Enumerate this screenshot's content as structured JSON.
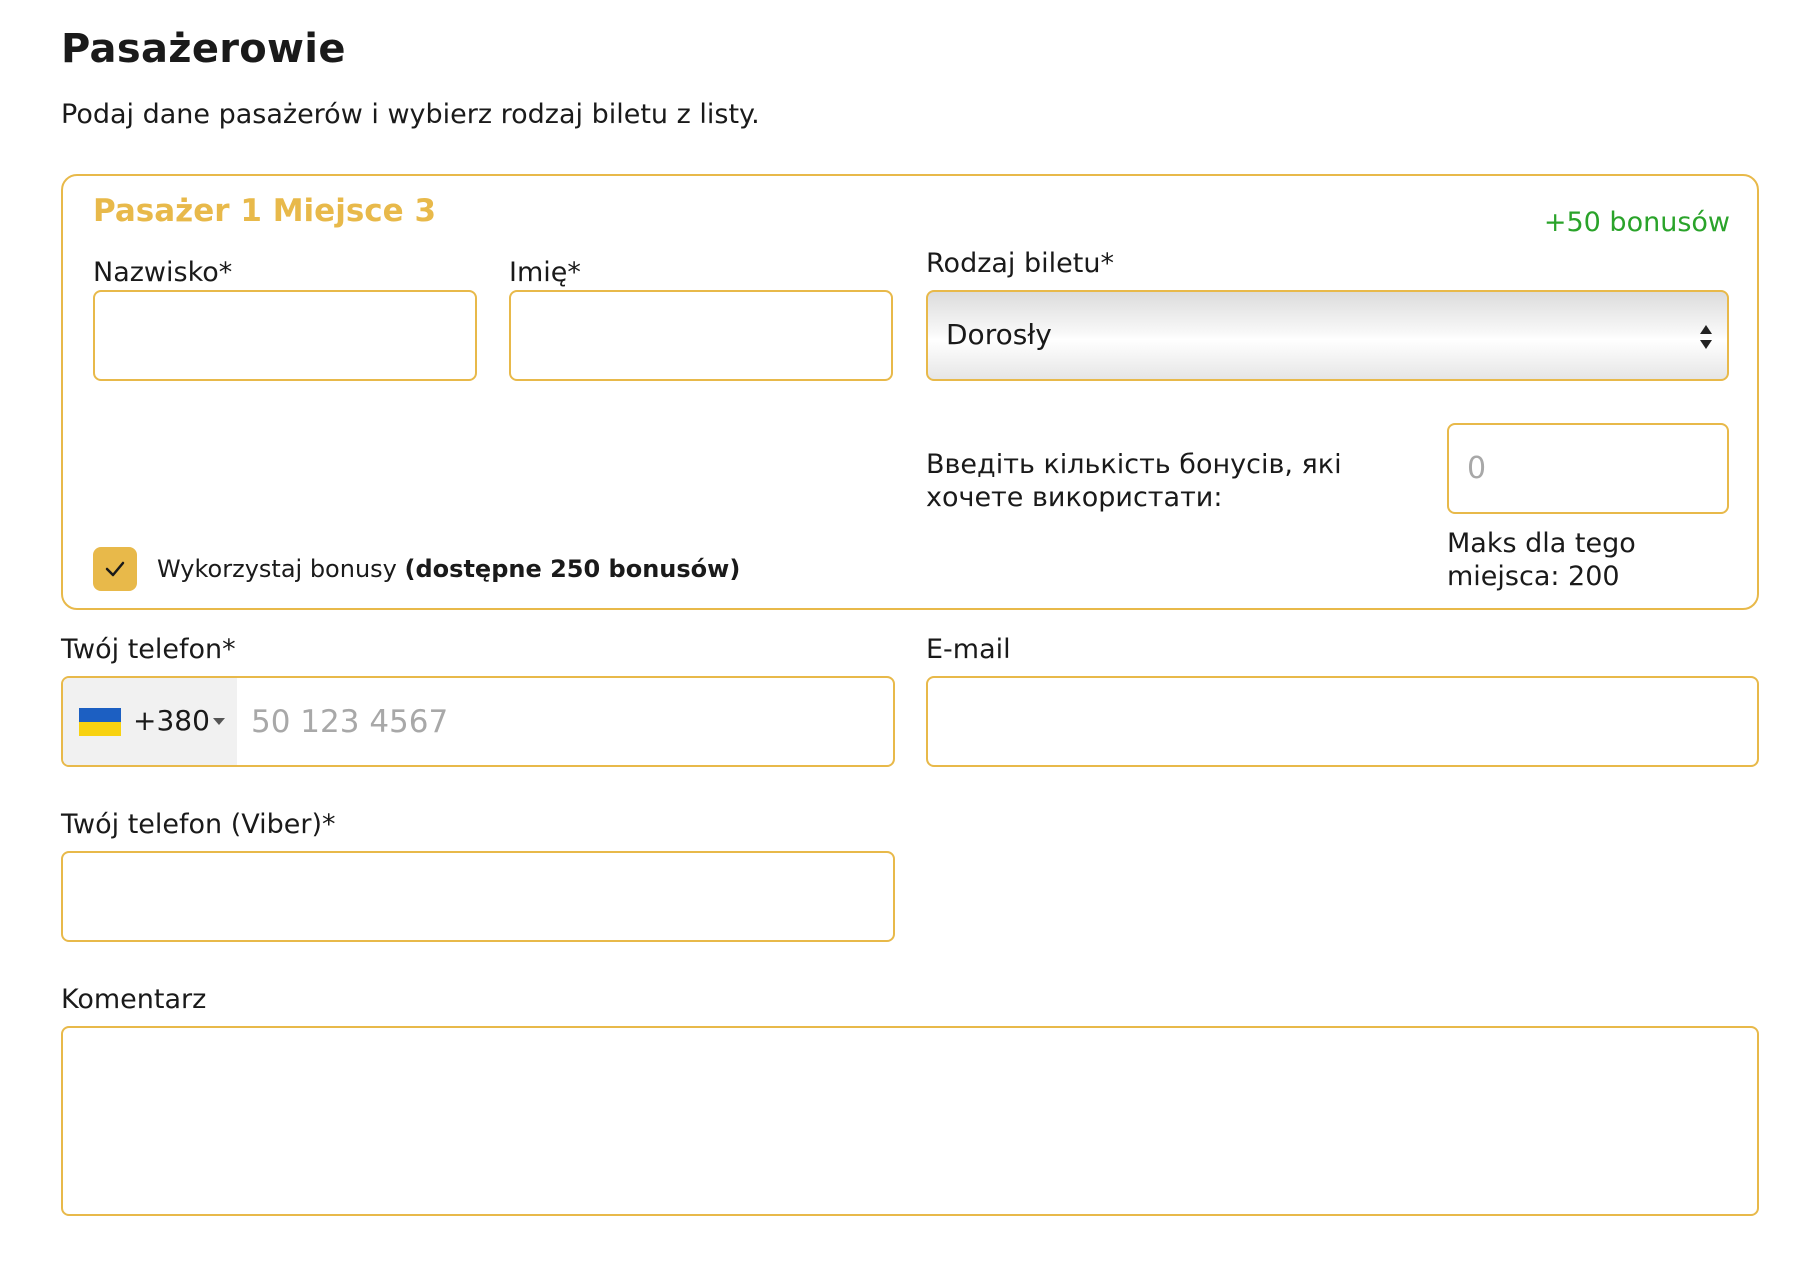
{
  "header": {
    "title": "Pasażerowie",
    "subtitle": "Podaj dane pasażerów i wybierz rodzaj biletu z listy."
  },
  "passenger": {
    "title": "Pasażer 1 Miejsce 3",
    "bonus_gain": "+50 bonusów",
    "surname_label": "Nazwisko*",
    "surname_value": "",
    "name_label": "Imię*",
    "name_value": "",
    "ticket_type_label": "Rodzaj biletu*",
    "ticket_type_value": "Dorosły",
    "bonus_question": "Введіть кількість бонусів, які хочете використати:",
    "bonus_amount_placeholder": "0",
    "max_note": "Maks dla tego miejsca: 200",
    "use_bonus_checked": true,
    "use_bonus_label": "Wykorzystaj bonusy",
    "use_bonus_available": "(dostępne 250 bonusów)"
  },
  "contact": {
    "phone_label": "Twój telefon*",
    "phone_country_code": "+380",
    "phone_country_flag": "ukraine-flag-icon",
    "phone_placeholder": "50 123 4567",
    "email_label": "E-mail",
    "email_value": "",
    "viber_label": "Twój telefon (Viber)*",
    "viber_value": "",
    "comment_label": "Komentarz",
    "comment_value": ""
  },
  "colors": {
    "accent": "#e8b94a",
    "bonus_green": "#2aa32a",
    "placeholder": "#a8a8a8"
  }
}
